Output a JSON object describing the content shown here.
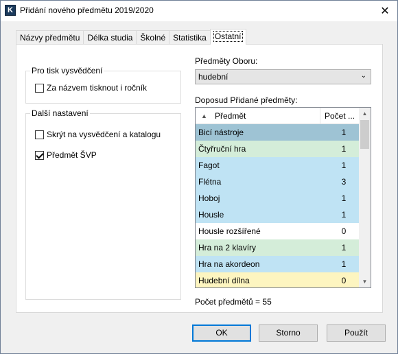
{
  "window": {
    "title": "Přidání nového předmětu 2019/2020",
    "app_icon": "K"
  },
  "tabs": [
    {
      "label": "Názvy předmětu",
      "active": false
    },
    {
      "label": "Délka studia",
      "active": false
    },
    {
      "label": "Školné",
      "active": false
    },
    {
      "label": "Statistika",
      "active": false
    },
    {
      "label": "Ostatní",
      "active": true
    }
  ],
  "print_group": {
    "title": "Pro tisk vysvědčení",
    "checkboxes": [
      {
        "label": "Za názvem tisknout i ročník",
        "checked": false
      }
    ]
  },
  "other_group": {
    "title": "Další nastavení",
    "checkboxes": [
      {
        "label": "Skrýt na vysvědčení a katalogu",
        "checked": false
      },
      {
        "label": "Předmět ŠVP",
        "checked": true
      }
    ]
  },
  "field_select": {
    "label": "Předměty Oboru:",
    "value": "hudební"
  },
  "subjects_list": {
    "label": "Doposud Přidané předměty:",
    "columns": [
      "Předmět",
      "Počet ..."
    ],
    "rows": [
      {
        "name": "Bicí nástroje",
        "count": "1",
        "color": "#9ec3d4"
      },
      {
        "name": "Čtyřruční hra",
        "count": "1",
        "color": "#d4edd9"
      },
      {
        "name": "Fagot",
        "count": "1",
        "color": "#bfe3f4"
      },
      {
        "name": "Flétna",
        "count": "3",
        "color": "#bfe3f4"
      },
      {
        "name": "Hoboj",
        "count": "1",
        "color": "#bfe3f4"
      },
      {
        "name": "Housle",
        "count": "1",
        "color": "#bfe3f4"
      },
      {
        "name": "Housle rozšířené",
        "count": "0",
        "color": "#ffffff"
      },
      {
        "name": "Hra na 2 klavíry",
        "count": "1",
        "color": "#d4edd9"
      },
      {
        "name": "Hra na akordeon",
        "count": "1",
        "color": "#bfe3f4"
      },
      {
        "name": "Hudební dílna",
        "count": "0",
        "color": "#fdf5c0"
      }
    ],
    "total": "Počet předmětů = 55"
  },
  "buttons": {
    "ok": "OK",
    "cancel": "Storno",
    "apply": "Použít"
  }
}
